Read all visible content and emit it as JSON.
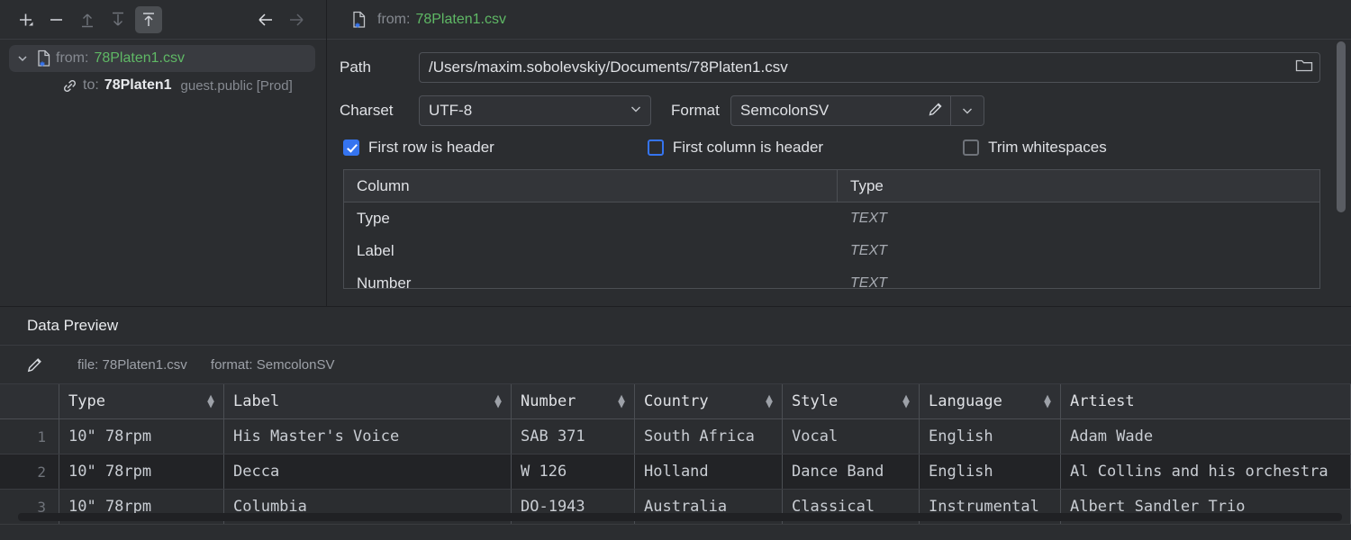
{
  "toolbar": {
    "add_label": "add-with-dropdown",
    "remove_label": "remove",
    "move_up_label": "move-up",
    "move_down_label": "move-down",
    "import_label": "import-to-target",
    "back_label": "back",
    "forward_label": "forward"
  },
  "tree": {
    "root": {
      "prefix": "from:",
      "name": "78Platen1.csv"
    },
    "child": {
      "prefix": "to:",
      "name": "78Platen1",
      "schema": "guest.public [Prod]"
    }
  },
  "settings": {
    "header_prefix": "from:",
    "header_name": "78Platen1.csv",
    "path_label": "Path",
    "path_value": "/Users/maxim.sobolevskiy/Documents/78Platen1.csv",
    "browse_icon": "folder-icon",
    "charset_label": "Charset",
    "charset_value": "UTF-8",
    "format_label": "Format",
    "format_value": "SemcolonSV",
    "edit_icon": "pencil-icon",
    "checkboxes": [
      {
        "label": "First row is header",
        "checked": true,
        "focused": false
      },
      {
        "label": "First column is header",
        "checked": false,
        "focused": true
      },
      {
        "label": "Trim whitespaces",
        "checked": false,
        "focused": false
      }
    ],
    "column_table": {
      "headers": [
        "Column",
        "Type"
      ],
      "rows": [
        {
          "column": "Type",
          "type": "TEXT"
        },
        {
          "column": "Label",
          "type": "TEXT"
        },
        {
          "column": "Number",
          "type": "TEXT"
        }
      ]
    }
  },
  "preview": {
    "title": "Data Preview",
    "edit_icon": "pencil-icon",
    "file_meta": "file: 78Platen1.csv",
    "format_meta": "format: SemcolonSV"
  },
  "chart_data": {
    "type": "table",
    "title": "Data Preview",
    "columns": [
      "Type",
      "Label",
      "Number",
      "Country",
      "Style",
      "Language",
      "Artiest"
    ],
    "row_numbers": [
      "1",
      "2",
      "3"
    ],
    "rows": [
      [
        "10\" 78rpm",
        "His Master's Voice",
        "SAB 371",
        "South Africa",
        "Vocal",
        "English",
        "Adam Wade"
      ],
      [
        "10\" 78rpm",
        "Decca",
        "W 126",
        "Holland",
        "Dance Band",
        "English",
        "Al Collins and his orchestra"
      ],
      [
        "10\" 78rpm",
        "Columbia",
        "DO-1943",
        "Australia",
        "Classical",
        "Instrumental",
        "Albert Sandler Trio"
      ]
    ],
    "selected_row_index": 1
  },
  "colors": {
    "accent": "#3574F0",
    "file_name_green": "#5FB865",
    "panel_bg": "#2B2D30",
    "window_bg": "#1E1F22",
    "text": "#DFE1E5",
    "muted_text": "#868A91"
  }
}
